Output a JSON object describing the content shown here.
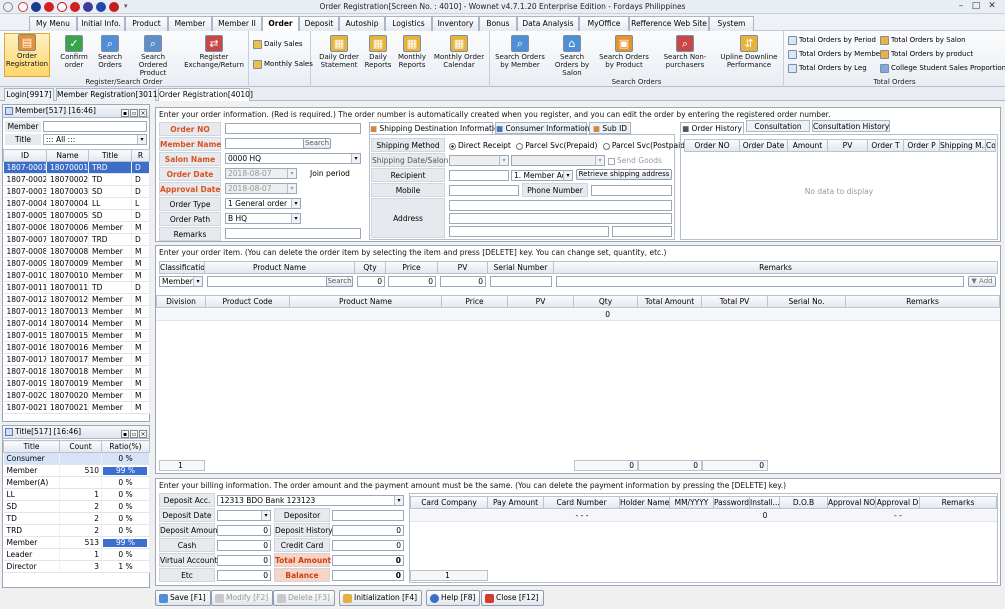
{
  "window": {
    "title": "Order Registration[Screen No. : 4010] - Wownet v4.7.1.20 Enterprise Edition - Fordays Philippines"
  },
  "menu": [
    "My Menu",
    "Initial Info.",
    "Product",
    "Member",
    "Member II",
    "Order",
    "Deposit",
    "Autoship",
    "Logistics",
    "Inventory",
    "Bonus",
    "Data Analysis",
    "MyOffice",
    "Refference Web Site",
    "System"
  ],
  "ribbon": {
    "reg_search_buttons": [
      "Order Registration",
      "Confirm order",
      "Search Orders",
      "Search Ordered Product",
      "Register Exchange/Return"
    ],
    "reg_search_title": "Register/Search Order",
    "sales_small": [
      "Daily Sales",
      "Monthly Sales"
    ],
    "stmt_buttons": [
      "Daily Order Statement",
      "Daily Reports",
      "Monthly Reports",
      "Monthly Order Calendar"
    ],
    "search_buttons": [
      "Search Orders by Member",
      "Search Orders by Salon",
      "Search Orders by Product",
      "Search Non-purchasers",
      "Upline Downline Performance"
    ],
    "search_title": "Search Orders",
    "total_items": [
      "Total Orders by Period",
      "Total Orders by Salon",
      "Total Orders by Member",
      "Total Orders by product",
      "Total Orders by Leg",
      "College Student Sales Proportion"
    ],
    "total_title": "Total Orders"
  },
  "doc_tabs": [
    "Login[9917]",
    "Member Registration[3011]",
    "Order Registration[4010]"
  ],
  "member_panel": {
    "title": "Member[517] [16:46]",
    "filter_label1": "Member",
    "filter_label2": "Title",
    "filter_value": "::: All :::",
    "columns": [
      "ID",
      "Name",
      "Title",
      "R"
    ],
    "rows": [
      [
        "1807-0001",
        "18070001",
        "TRD",
        "D"
      ],
      [
        "1807-0002",
        "18070002",
        "TD",
        "D"
      ],
      [
        "1807-0003",
        "18070003",
        "SD",
        "D"
      ],
      [
        "1807-0004",
        "18070004",
        "LL",
        "L"
      ],
      [
        "1807-0005",
        "18070005",
        "SD",
        "D"
      ],
      [
        "1807-0006",
        "18070006",
        "Member",
        "M"
      ],
      [
        "1807-0007",
        "18070007",
        "TRD",
        "D"
      ],
      [
        "1807-0008",
        "18070008",
        "Member",
        "M"
      ],
      [
        "1807-0009",
        "18070009",
        "Member",
        "M"
      ],
      [
        "1807-0010",
        "18070010",
        "Member",
        "M"
      ],
      [
        "1807-0011",
        "18070011",
        "TD",
        "D"
      ],
      [
        "1807-0012",
        "18070012",
        "Member",
        "M"
      ],
      [
        "1807-0013",
        "18070013",
        "Member",
        "M"
      ],
      [
        "1807-0014",
        "18070014",
        "Member",
        "M"
      ],
      [
        "1807-0015",
        "18070015",
        "Member",
        "M"
      ],
      [
        "1807-0016",
        "18070016",
        "Member",
        "M"
      ],
      [
        "1807-0017",
        "18070017",
        "Member",
        "M"
      ],
      [
        "1807-0018",
        "18070018",
        "Member",
        "M"
      ],
      [
        "1807-0019",
        "18070019",
        "Member",
        "M"
      ],
      [
        "1807-0020",
        "18070020",
        "Member",
        "M"
      ],
      [
        "1807-0021",
        "18070021",
        "Member",
        "M"
      ]
    ]
  },
  "title_panel": {
    "title": "Title[517] [16:46]",
    "columns": [
      "Title",
      "Count",
      "Ratio(%)"
    ],
    "rows": [
      {
        "title": "Consumer",
        "count": "",
        "ratio": "0 %",
        "fill": 0
      },
      {
        "title": "Member",
        "count": "510",
        "ratio": "99 %",
        "fill": 0.99
      },
      {
        "title": "Member(A)",
        "count": "",
        "ratio": "0 %",
        "fill": 0
      },
      {
        "title": "LL",
        "count": "1",
        "ratio": "0 %",
        "fill": 0
      },
      {
        "title": "SD",
        "count": "2",
        "ratio": "0 %",
        "fill": 0
      },
      {
        "title": "TD",
        "count": "2",
        "ratio": "0 %",
        "fill": 0
      },
      {
        "title": "TRD",
        "count": "2",
        "ratio": "0 %",
        "fill": 0
      },
      {
        "title": "Member",
        "count": "513",
        "ratio": "99 %",
        "fill": 0.99
      },
      {
        "title": "Leader",
        "count": "1",
        "ratio": "0 %",
        "fill": 0
      },
      {
        "title": "Director",
        "count": "3",
        "ratio": "1 %",
        "fill": 0.01
      }
    ]
  },
  "order_info": {
    "header": "Enter your order information. (Red is required.) The order number is automatically created when you register, and you can edit the order by entering the registered order number.",
    "labels": {
      "order_no": "Order NO",
      "member_name": "Member Name",
      "salon_name": "Salon Name",
      "order_date": "Order Date",
      "approval_date": "Approval Date",
      "order_type": "Order Type",
      "order_path": "Order Path",
      "remarks": "Remarks"
    },
    "search_btn": "Search",
    "salon_value": "0000 HQ",
    "order_date": "2018-08-07",
    "approval_date": "2018-08-07",
    "join_period": "Join period",
    "order_type_value": "1 General order",
    "order_path_value": "B HQ"
  },
  "shipping": {
    "tabs": [
      "Shipping Destination Information",
      "Consumer Information",
      "Sub ID"
    ],
    "labels": {
      "method": "Shipping Method",
      "date": "Shipping Date/Salon",
      "recipient": "Recipient",
      "mobile": "Mobile",
      "phone": "Phone Number",
      "address": "Address"
    },
    "options": [
      "Direct Receipt",
      "Parcel Svc(Prepaid)",
      "Parcel Svc(Postpaid)"
    ],
    "send_goods": "Send Goods",
    "recipient_type": "1. Member Addr",
    "retrieve_btn": "Retrieve shipping address"
  },
  "history": {
    "tabs": [
      "Order History",
      "Consultation",
      "Consultation History"
    ],
    "columns": [
      "Order NO",
      "Order Date",
      "Amount",
      "PV",
      "Order T",
      "Order P",
      "Shipping M...",
      "Co"
    ],
    "empty": "No data to display"
  },
  "items": {
    "header": "Enter your order item. (You can delete the order item by selecting the item and press [DELETE] key. You can change set, quantity, etc.)",
    "entry_columns": [
      "Classification",
      "Product Name",
      "Qty",
      "Price",
      "PV",
      "Serial Number",
      "Remarks"
    ],
    "class_value": "Member",
    "search_btn": "Search",
    "qty": "0",
    "price": "0",
    "pv": "0",
    "add_btn": "Add",
    "columns": [
      "Division",
      "Product Code",
      "Product Name",
      "Price",
      "PV",
      "Qty",
      "Total Amount",
      "Total PV",
      "Serial No.",
      "Remarks"
    ],
    "row_qty": "0",
    "footer": [
      "1",
      "0",
      "0",
      "0"
    ]
  },
  "billing": {
    "header": "Enter your billing information. The order amount and the payment amount must be the same. (You can delete the payment information by pressing the [DELETE] key.)",
    "labels": {
      "deposit_acc": "Deposit Acc.",
      "deposit_date": "Deposit Date",
      "depositor": "Depositor",
      "deposit_amount": "Deposit Amount",
      "deposit_history": "Deposit History",
      "cash": "Cash",
      "credit_card": "Credit Card",
      "virtual_account": "Virtual Account",
      "total_amount": "Total Amount",
      "etc": "Etc",
      "balance": "Balance"
    },
    "deposit_acc_value": "12313 BDO Bank 123123",
    "values": {
      "deposit_amount": "0",
      "deposit_history": "0",
      "cash": "0",
      "credit_card": "0",
      "virtual_account": "0",
      "total_amount": "0",
      "etc": "0",
      "balance": "0"
    },
    "card_columns": [
      "Card Company",
      "Pay Amount",
      "Card Number",
      "Holder Name",
      "MM/YYYY",
      "Password",
      "Install...",
      "D.O.B",
      "Approval NO",
      "Approval D",
      "Remarks"
    ],
    "card_row": {
      "card_number": "-   -   -",
      "install": "0",
      "approval_d": "-  -"
    },
    "card_footer": "1"
  },
  "bottom_buttons": [
    "Save [F1]",
    "Modify [F2]",
    "Delete [F3]",
    "Initialization [F4]",
    "Help [F8]",
    "Close [F12]"
  ],
  "colors": {
    "accent": "#3c6ec8",
    "required": "#d9531e",
    "ratio_bar": "#3b6fd0"
  }
}
